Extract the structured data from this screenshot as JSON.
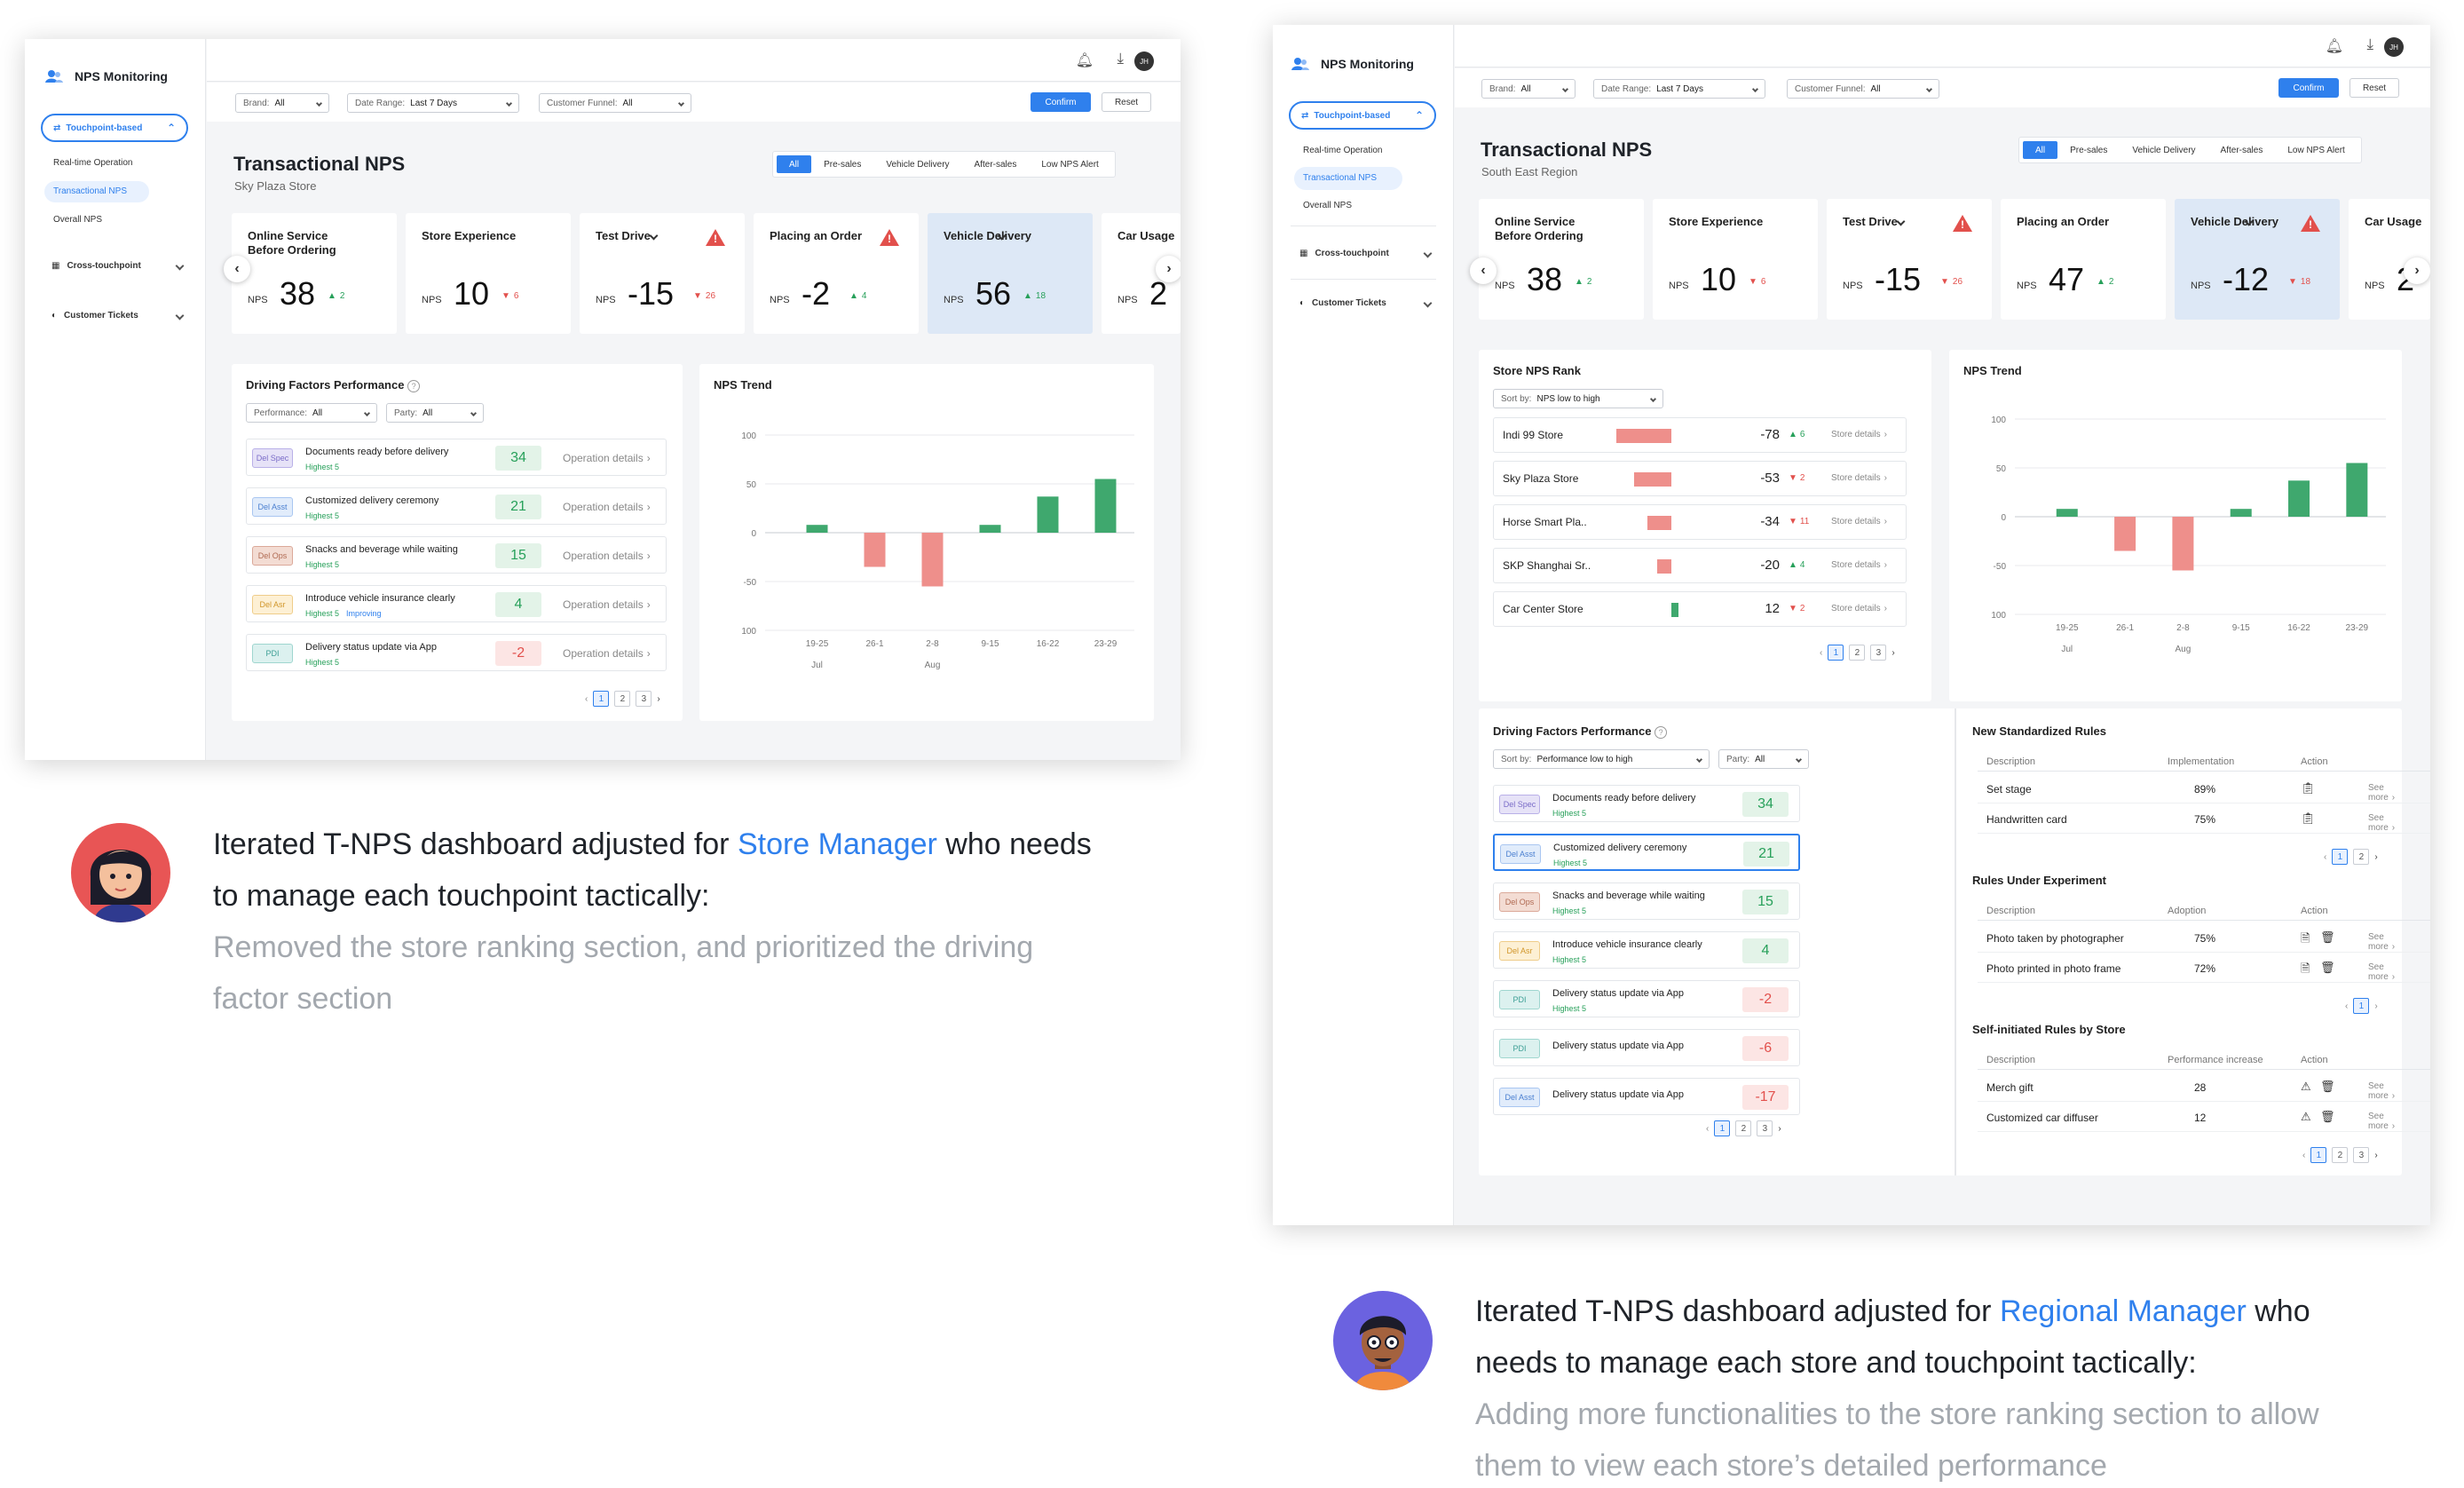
{
  "left": {
    "app_name": "NPS Monitoring",
    "nav": {
      "touchpoint": "Touchpoint-based",
      "sub": [
        "Real-time Operation",
        "Transactional NPS",
        "Overall NPS"
      ],
      "cross": "Cross-touchpoint",
      "tickets": "Customer Tickets"
    },
    "user_initials": "JH",
    "filters": {
      "brand_label": "Brand:",
      "brand_value": "All",
      "range_label": "Date Range:",
      "range_value": "Last 7 Days",
      "funnel_label": "Customer Funnel:",
      "funnel_value": "All",
      "confirm": "Confirm",
      "reset": "Reset"
    },
    "title": "Transactional NPS",
    "subtitle": "Sky Plaza Store",
    "tabs": [
      "All",
      "Pre-sales",
      "Vehicle Delivery",
      "After-sales",
      "Low NPS Alert"
    ],
    "nps_label": "NPS",
    "cards": [
      {
        "name": "Online Service Before Ordering",
        "value": "38",
        "delta": "2",
        "dir": "up",
        "warn": false,
        "selected": false
      },
      {
        "name": "Store Experience",
        "value": "10",
        "delta": "6",
        "dir": "down",
        "warn": false,
        "selected": false
      },
      {
        "name": "Test Drive",
        "value": "-15",
        "delta": "26",
        "dir": "down",
        "warn": true,
        "selected": false
      },
      {
        "name": "Placing an Order",
        "value": "-2",
        "delta": "4",
        "dir": "up",
        "warn": true,
        "selected": false
      },
      {
        "name": "Vehicle Delivery",
        "value": "56",
        "delta": "18",
        "dir": "up",
        "warn": false,
        "selected": true
      },
      {
        "name": "Car Usage",
        "value": "2",
        "delta": "",
        "dir": "up",
        "warn": false,
        "selected": false
      }
    ],
    "driving": {
      "title": "Driving Factors Performance",
      "perf_label": "Performance:",
      "perf_value": "All",
      "party_label": "Party:",
      "party_value": "All",
      "details": "Operation details",
      "rows": [
        {
          "tag": "Del Spec",
          "text": "Documents ready before delivery",
          "sub": "Highest 5",
          "sub2": "",
          "score": "34",
          "good": true
        },
        {
          "tag": "Del Asst",
          "text": "Customized delivery ceremony",
          "sub": "Highest 5",
          "sub2": "",
          "score": "21",
          "good": true
        },
        {
          "tag": "Del Ops",
          "text": "Snacks and beverage while waiting",
          "sub": "Highest 5",
          "sub2": "",
          "score": "15",
          "good": true
        },
        {
          "tag": "Del Asr",
          "text": "Introduce vehicle insurance clearly",
          "sub": "Highest 5",
          "sub2": "Improving",
          "score": "4",
          "good": true
        },
        {
          "tag": "PDI",
          "text": "Delivery status update via App",
          "sub": "Highest 5",
          "sub2": "",
          "score": "-2",
          "good": false
        }
      ],
      "pages": [
        "1",
        "2",
        "3"
      ]
    },
    "trend_title": "NPS Trend",
    "chart_data": {
      "type": "bar",
      "title": "NPS Trend",
      "categories": [
        "19-25",
        "26-1",
        "2-8",
        "9-15",
        "16-22",
        "23-29"
      ],
      "months": [
        "Jul",
        "Aug"
      ],
      "values": [
        8,
        -35,
        -55,
        8,
        37,
        55
      ],
      "yticks": [
        "100",
        "50",
        "0",
        "-50",
        "100"
      ],
      "ylim": [
        -100,
        100
      ]
    },
    "caption": {
      "line1a": "Iterated T-NPS dashboard adjusted for ",
      "role": "Store Manager",
      "line1b": " who needs",
      "line2": "to manage each touchpoint tactically:",
      "muted1": "Removed the store ranking section, and prioritized the driving",
      "muted2": "factor section"
    }
  },
  "right": {
    "app_name": "NPS Monitoring",
    "nav": {
      "touchpoint": "Touchpoint-based",
      "sub": [
        "Real-time Operation",
        "Transactional NPS",
        "Overall NPS"
      ],
      "cross": "Cross-touchpoint",
      "tickets": "Customer Tickets"
    },
    "user_initials": "JH",
    "filters": {
      "brand_label": "Brand:",
      "brand_value": "All",
      "range_label": "Date Range:",
      "range_value": "Last 7 Days",
      "funnel_label": "Customer Funnel:",
      "funnel_value": "All",
      "confirm": "Confirm",
      "reset": "Reset"
    },
    "title": "Transactional NPS",
    "subtitle": "South East Region",
    "tabs": [
      "All",
      "Pre-sales",
      "Vehicle Delivery",
      "After-sales",
      "Low NPS Alert"
    ],
    "nps_label": "NPS",
    "cards": [
      {
        "name": "Online Service Before Ordering",
        "value": "38",
        "delta": "2",
        "dir": "up",
        "warn": false,
        "selected": false
      },
      {
        "name": "Store Experience",
        "value": "10",
        "delta": "6",
        "dir": "down",
        "warn": false,
        "selected": false
      },
      {
        "name": "Test Drive",
        "value": "-15",
        "delta": "26",
        "dir": "down",
        "warn": true,
        "selected": false
      },
      {
        "name": "Placing an Order",
        "value": "47",
        "delta": "2",
        "dir": "up",
        "warn": false,
        "selected": false
      },
      {
        "name": "Vehicle Delivery",
        "value": "-12",
        "delta": "18",
        "dir": "down",
        "warn": true,
        "selected": true
      },
      {
        "name": "Car Usage",
        "value": "2",
        "delta": "",
        "dir": "up",
        "warn": false,
        "selected": false
      }
    ],
    "rank": {
      "title": "Store NPS Rank",
      "sort_label": "Sort by:",
      "sort_value": "NPS low to high",
      "details": "Store details",
      "rows": [
        {
          "store": "Indi 99 Store",
          "nps": "-78",
          "delta": "6",
          "dir": "up",
          "bar": 78
        },
        {
          "store": "Sky Plaza Store",
          "nps": "-53",
          "delta": "2",
          "dir": "down",
          "bar": 53
        },
        {
          "store": "Horse Smart Pla..",
          "nps": "-34",
          "delta": "11",
          "dir": "down",
          "bar": 34
        },
        {
          "store": "SKP Shanghai Sr..",
          "nps": "-20",
          "delta": "4",
          "dir": "up",
          "bar": 20
        },
        {
          "store": "Car Center Store",
          "nps": "12",
          "delta": "2",
          "dir": "down",
          "bar": 12
        }
      ],
      "pages": [
        "1",
        "2",
        "3"
      ]
    },
    "trend_title": "NPS Trend",
    "chart_data": {
      "type": "bar",
      "title": "NPS Trend",
      "categories": [
        "19-25",
        "26-1",
        "2-8",
        "9-15",
        "16-22",
        "23-29"
      ],
      "months": [
        "Jul",
        "Aug"
      ],
      "values": [
        8,
        -35,
        -55,
        8,
        37,
        55
      ],
      "yticks": [
        "100",
        "50",
        "0",
        "-50",
        "100"
      ],
      "ylim": [
        -100,
        100
      ]
    },
    "driving": {
      "title": "Driving Factors Performance",
      "sort_label": "Sort by:",
      "sort_value": "Performance low to high",
      "party_label": "Party:",
      "party_value": "All",
      "rows": [
        {
          "tag": "Del Spec",
          "text": "Documents ready before delivery",
          "sub": "Highest 5",
          "score": "34",
          "good": true
        },
        {
          "tag": "Del Asst",
          "text": "Customized delivery ceremony",
          "sub": "Highest 5",
          "score": "21",
          "good": true
        },
        {
          "tag": "Del Ops",
          "text": "Snacks and beverage while waiting",
          "sub": "Highest 5",
          "score": "15",
          "good": true
        },
        {
          "tag": "Del Asr",
          "text": "Introduce vehicle insurance clearly",
          "sub": "Highest 5",
          "score": "4",
          "good": true
        },
        {
          "tag": "PDI",
          "text": "Delivery status update via App",
          "sub": "Highest 5",
          "score": "-2",
          "good": false
        },
        {
          "tag": "PDI",
          "text": "Delivery status update via App",
          "sub": "",
          "score": "-6",
          "good": false
        },
        {
          "tag": "Del Asst",
          "text": "Delivery status update via App",
          "sub": "",
          "score": "-17",
          "good": false
        }
      ],
      "pages": [
        "1",
        "2",
        "3"
      ]
    },
    "rules": {
      "title": "New Standardized Rules",
      "headers": [
        "Description",
        "Implementation",
        "Action"
      ],
      "rows": [
        {
          "desc": "Set stage",
          "val": "89%",
          "more": "See more"
        },
        {
          "desc": "Handwritten card",
          "val": "75%",
          "more": "See more"
        }
      ],
      "pages": [
        "1",
        "2"
      ]
    },
    "experiment": {
      "title": "Rules Under Experiment",
      "headers": [
        "Description",
        "Adoption",
        "Action"
      ],
      "rows": [
        {
          "desc": "Photo taken by photographer",
          "val": "75%",
          "more": "See more"
        },
        {
          "desc": "Photo printed in photo frame",
          "val": "72%",
          "more": "See more"
        }
      ],
      "pages": [
        "1"
      ]
    },
    "self": {
      "title": "Self-initiated Rules by Store",
      "headers": [
        "Description",
        "Performance increase",
        "Action"
      ],
      "rows": [
        {
          "desc": "Merch gift",
          "val": "28",
          "more": "See more"
        },
        {
          "desc": "Customized car diffuser",
          "val": "12",
          "more": "See more"
        }
      ],
      "pages": [
        "1",
        "2",
        "3"
      ]
    },
    "caption": {
      "line1a": "Iterated T-NPS dashboard adjusted for ",
      "role": "Regional Manager",
      "line1b": " who",
      "line2": "needs to manage each store and touchpoint tactically:",
      "muted1": "Adding more functionalities to the store ranking section to allow",
      "muted2": "them to view each store’s detailed performance"
    }
  },
  "colors": {
    "accent": "#2f80ed",
    "positive": "#27a05a",
    "negative": "#e2504c",
    "bar_positive": "#3fa86e",
    "bar_negative": "#ee8f8b",
    "selected_card": "#dde8f6"
  }
}
